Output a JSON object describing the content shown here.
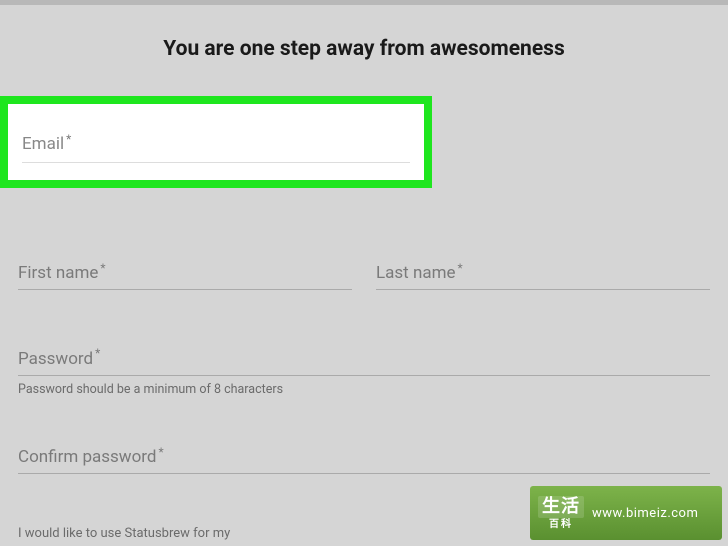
{
  "page": {
    "title": "You are one step away from awesomeness"
  },
  "form": {
    "email": {
      "label": "Email",
      "required_mark": "*"
    },
    "first_name": {
      "label": "First name",
      "required_mark": "*"
    },
    "last_name": {
      "label": "Last name",
      "required_mark": "*"
    },
    "password": {
      "label": "Password",
      "required_mark": "*",
      "hint": "Password should be a minimum of 8 characters"
    },
    "confirm_password": {
      "label": "Confirm password",
      "required_mark": "*"
    },
    "usage_label": "I would like to use Statusbrew for my"
  },
  "watermark": {
    "badge_top": "生活",
    "badge_bottom": "百科",
    "url": "www.bimeiz.com"
  }
}
